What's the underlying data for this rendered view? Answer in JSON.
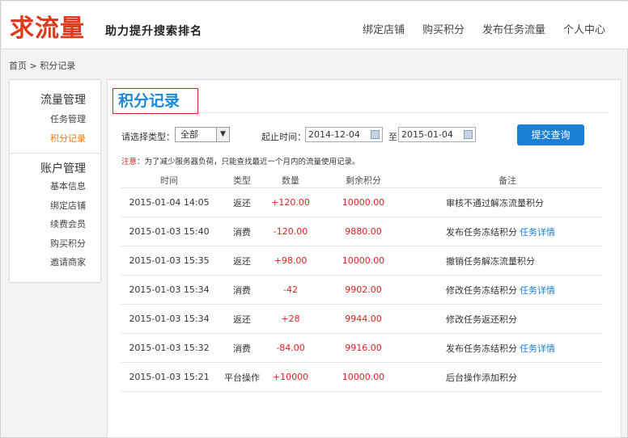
{
  "header": {
    "logo": "求流量",
    "slogan": "助力提升搜索排名",
    "nav": [
      "绑定店铺",
      "购买积分",
      "发布任务流量",
      "个人中心"
    ]
  },
  "breadcrumb": "首页 > 积分记录",
  "sidebar": {
    "group1_title": "流量管理",
    "group1_items": [
      "任务管理",
      "积分记录"
    ],
    "group2_title": "账户管理",
    "group2_items": [
      "基本信息",
      "绑定店铺",
      "续费会员",
      "购买积分",
      "邀请商家"
    ]
  },
  "main": {
    "title": "积分记录",
    "filter": {
      "type_label": "请选择类型：",
      "type_value": "全部",
      "time_label": "起止时间：",
      "start_date": "2014-12-04",
      "to_label": "至",
      "end_date": "2015-01-04",
      "submit": "提交查询"
    },
    "notice_prefix": "注意",
    "notice_text": "：为了减少服务器负荷，只能查找最近一个月内的流量使用记录。",
    "table": {
      "headers": [
        "时间",
        "类型",
        "数量",
        "剩余积分",
        "备注"
      ],
      "rows": [
        {
          "time": "2015-01-04 14:05",
          "type": "返还",
          "amount": "+120.00",
          "balance": "10000.00",
          "note": "审核不通过解冻流量积分",
          "link": ""
        },
        {
          "time": "2015-01-03 15:40",
          "type": "消费",
          "amount": "-120.00",
          "balance": "9880.00",
          "note": "发布任务冻结积分",
          "link": "任务详情"
        },
        {
          "time": "2015-01-03 15:35",
          "type": "返还",
          "amount": "+98.00",
          "balance": "10000.00",
          "note": "撤销任务解冻流量积分",
          "link": ""
        },
        {
          "time": "2015-01-03 15:34",
          "type": "消费",
          "amount": "-42",
          "balance": "9902.00",
          "note": "修改任务冻结积分",
          "link": "任务详情"
        },
        {
          "time": "2015-01-03 15:34",
          "type": "返还",
          "amount": "+28",
          "balance": "9944.00",
          "note": "修改任务返还积分",
          "link": ""
        },
        {
          "time": "2015-01-03 15:32",
          "type": "消费",
          "amount": "-84.00",
          "balance": "9916.00",
          "note": "发布任务冻结积分",
          "link": "任务详情"
        },
        {
          "time": "2015-01-03 15:21",
          "type": "平台操作",
          "amount": "+10000",
          "balance": "10000.00",
          "note": "后台操作添加积分",
          "link": ""
        }
      ]
    }
  },
  "colors": {
    "accent_blue": "#1a88d6",
    "active_orange": "#f07a16",
    "value_red": "#e02020",
    "button_blue": "#1b7fd5"
  }
}
